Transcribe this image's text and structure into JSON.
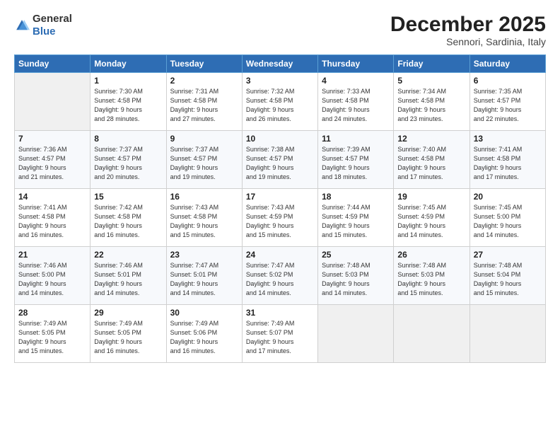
{
  "logo": {
    "general": "General",
    "blue": "Blue"
  },
  "header": {
    "month": "December 2025",
    "location": "Sennori, Sardinia, Italy"
  },
  "days_of_week": [
    "Sunday",
    "Monday",
    "Tuesday",
    "Wednesday",
    "Thursday",
    "Friday",
    "Saturday"
  ],
  "weeks": [
    [
      {
        "day": "",
        "info": ""
      },
      {
        "day": "1",
        "info": "Sunrise: 7:30 AM\nSunset: 4:58 PM\nDaylight: 9 hours\nand 28 minutes."
      },
      {
        "day": "2",
        "info": "Sunrise: 7:31 AM\nSunset: 4:58 PM\nDaylight: 9 hours\nand 27 minutes."
      },
      {
        "day": "3",
        "info": "Sunrise: 7:32 AM\nSunset: 4:58 PM\nDaylight: 9 hours\nand 26 minutes."
      },
      {
        "day": "4",
        "info": "Sunrise: 7:33 AM\nSunset: 4:58 PM\nDaylight: 9 hours\nand 24 minutes."
      },
      {
        "day": "5",
        "info": "Sunrise: 7:34 AM\nSunset: 4:58 PM\nDaylight: 9 hours\nand 23 minutes."
      },
      {
        "day": "6",
        "info": "Sunrise: 7:35 AM\nSunset: 4:57 PM\nDaylight: 9 hours\nand 22 minutes."
      }
    ],
    [
      {
        "day": "7",
        "info": "Sunrise: 7:36 AM\nSunset: 4:57 PM\nDaylight: 9 hours\nand 21 minutes."
      },
      {
        "day": "8",
        "info": "Sunrise: 7:37 AM\nSunset: 4:57 PM\nDaylight: 9 hours\nand 20 minutes."
      },
      {
        "day": "9",
        "info": "Sunrise: 7:37 AM\nSunset: 4:57 PM\nDaylight: 9 hours\nand 19 minutes."
      },
      {
        "day": "10",
        "info": "Sunrise: 7:38 AM\nSunset: 4:57 PM\nDaylight: 9 hours\nand 19 minutes."
      },
      {
        "day": "11",
        "info": "Sunrise: 7:39 AM\nSunset: 4:57 PM\nDaylight: 9 hours\nand 18 minutes."
      },
      {
        "day": "12",
        "info": "Sunrise: 7:40 AM\nSunset: 4:58 PM\nDaylight: 9 hours\nand 17 minutes."
      },
      {
        "day": "13",
        "info": "Sunrise: 7:41 AM\nSunset: 4:58 PM\nDaylight: 9 hours\nand 17 minutes."
      }
    ],
    [
      {
        "day": "14",
        "info": "Sunrise: 7:41 AM\nSunset: 4:58 PM\nDaylight: 9 hours\nand 16 minutes."
      },
      {
        "day": "15",
        "info": "Sunrise: 7:42 AM\nSunset: 4:58 PM\nDaylight: 9 hours\nand 16 minutes."
      },
      {
        "day": "16",
        "info": "Sunrise: 7:43 AM\nSunset: 4:58 PM\nDaylight: 9 hours\nand 15 minutes."
      },
      {
        "day": "17",
        "info": "Sunrise: 7:43 AM\nSunset: 4:59 PM\nDaylight: 9 hours\nand 15 minutes."
      },
      {
        "day": "18",
        "info": "Sunrise: 7:44 AM\nSunset: 4:59 PM\nDaylight: 9 hours\nand 15 minutes."
      },
      {
        "day": "19",
        "info": "Sunrise: 7:45 AM\nSunset: 4:59 PM\nDaylight: 9 hours\nand 14 minutes."
      },
      {
        "day": "20",
        "info": "Sunrise: 7:45 AM\nSunset: 5:00 PM\nDaylight: 9 hours\nand 14 minutes."
      }
    ],
    [
      {
        "day": "21",
        "info": "Sunrise: 7:46 AM\nSunset: 5:00 PM\nDaylight: 9 hours\nand 14 minutes."
      },
      {
        "day": "22",
        "info": "Sunrise: 7:46 AM\nSunset: 5:01 PM\nDaylight: 9 hours\nand 14 minutes."
      },
      {
        "day": "23",
        "info": "Sunrise: 7:47 AM\nSunset: 5:01 PM\nDaylight: 9 hours\nand 14 minutes."
      },
      {
        "day": "24",
        "info": "Sunrise: 7:47 AM\nSunset: 5:02 PM\nDaylight: 9 hours\nand 14 minutes."
      },
      {
        "day": "25",
        "info": "Sunrise: 7:48 AM\nSunset: 5:03 PM\nDaylight: 9 hours\nand 14 minutes."
      },
      {
        "day": "26",
        "info": "Sunrise: 7:48 AM\nSunset: 5:03 PM\nDaylight: 9 hours\nand 15 minutes."
      },
      {
        "day": "27",
        "info": "Sunrise: 7:48 AM\nSunset: 5:04 PM\nDaylight: 9 hours\nand 15 minutes."
      }
    ],
    [
      {
        "day": "28",
        "info": "Sunrise: 7:49 AM\nSunset: 5:05 PM\nDaylight: 9 hours\nand 15 minutes."
      },
      {
        "day": "29",
        "info": "Sunrise: 7:49 AM\nSunset: 5:05 PM\nDaylight: 9 hours\nand 16 minutes."
      },
      {
        "day": "30",
        "info": "Sunrise: 7:49 AM\nSunset: 5:06 PM\nDaylight: 9 hours\nand 16 minutes."
      },
      {
        "day": "31",
        "info": "Sunrise: 7:49 AM\nSunset: 5:07 PM\nDaylight: 9 hours\nand 17 minutes."
      },
      {
        "day": "",
        "info": ""
      },
      {
        "day": "",
        "info": ""
      },
      {
        "day": "",
        "info": ""
      }
    ]
  ]
}
